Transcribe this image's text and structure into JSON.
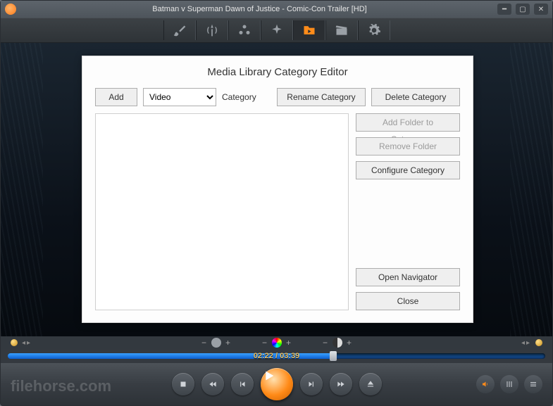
{
  "window": {
    "title": "Batman v Superman  Dawn of Justice - Comic-Con Trailer [HD]"
  },
  "dialog": {
    "heading": "Media Library Category Editor",
    "add_label": "Add",
    "category_select_value": "Video",
    "category_label": "Category",
    "rename_label": "Rename Category",
    "delete_label": "Delete Category",
    "add_folder_label": "Add Folder to Category",
    "remove_folder_label": "Remove Folder",
    "configure_label": "Configure Category",
    "open_nav_label": "Open Navigator",
    "close_label": "Close"
  },
  "playback": {
    "time_current": "02:22",
    "time_total": "03:39",
    "time_separator": " / "
  },
  "watermark": "filehorse.com"
}
